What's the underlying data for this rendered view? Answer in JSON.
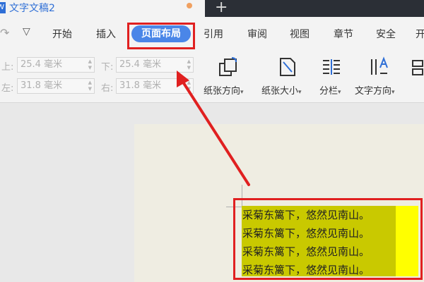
{
  "window": {
    "doc_icon": "W",
    "doc_title": "文字文稿2",
    "new_tab": "+"
  },
  "menu": {
    "undo": "↷",
    "more": "▽",
    "items": [
      "开始",
      "插入",
      "页面布局",
      "引用",
      "审阅",
      "视图",
      "章节",
      "安全",
      "开"
    ],
    "active_index": 2
  },
  "margins": {
    "top_label": "上:",
    "top_value": "25.4 毫米",
    "bottom_label": "下:",
    "bottom_value": "25.4 毫米",
    "left_label": "左:",
    "left_value": "31.8 毫米",
    "right_label": "右:",
    "right_value": "31.8 毫米"
  },
  "tools": {
    "orientation": "纸张方向",
    "size": "纸张大小",
    "columns": "分栏",
    "text_direction": "文字方向",
    "dropdown_glyph": "▾"
  },
  "document": {
    "lines": [
      "采菊东篱下，悠然见南山。",
      "采菊东篱下，悠然见南山。",
      "采菊东篱下，悠然见南山。",
      "采菊东篱下，悠然见南山。"
    ]
  },
  "colors": {
    "accent": "#4a86e8",
    "annotation": "#e02020",
    "highlight": "#ffff00",
    "selection": "#c9c900"
  }
}
